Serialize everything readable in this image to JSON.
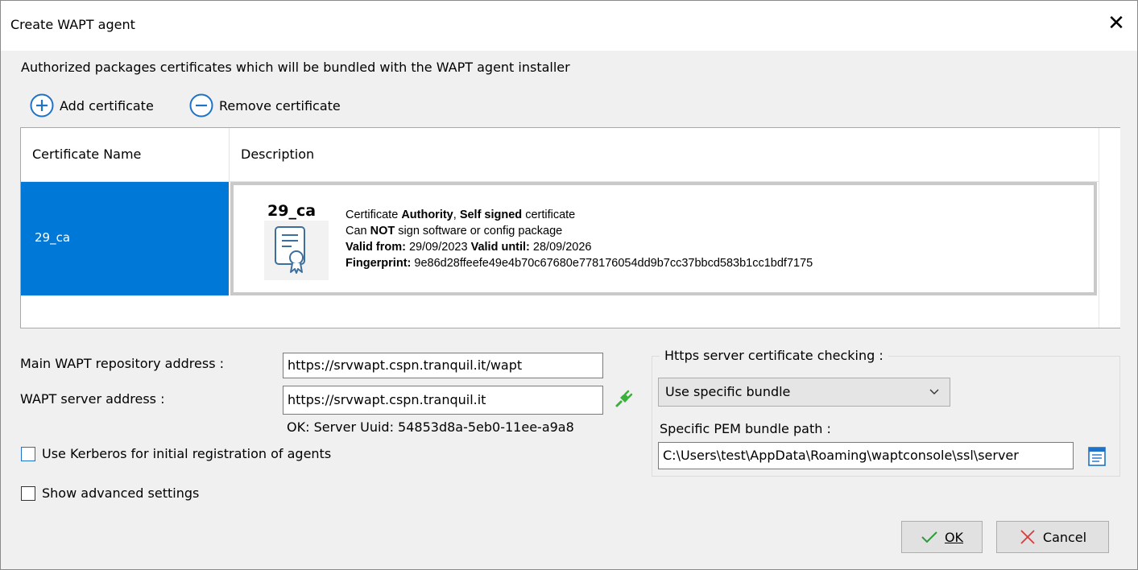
{
  "window": {
    "title": "Create WAPT agent",
    "close_glyph": "✕"
  },
  "certificates": {
    "heading": "Authorized packages certificates which will be bundled with the WAPT agent installer",
    "add_label": "Add certificate",
    "remove_label": "Remove certificate",
    "columns": [
      "Certificate Name",
      "Description"
    ],
    "rows": [
      {
        "name": "29_ca",
        "big_name": "29_ca",
        "line1": {
          "a": "Certificate ",
          "b": "Authority",
          "c": ", ",
          "d": "Self signed",
          "e": " certificate"
        },
        "line2": {
          "a": "Can ",
          "b": "NOT",
          "c": " sign software or config package"
        },
        "line3": {
          "a": "Valid from:",
          "b": " 29/09/2023 ",
          "c": "Valid until:",
          "d": " 28/09/2026"
        },
        "line4": {
          "a": "Fingerprint:",
          "b": " 9e86d28ffeefe49e4b70c67680e778176054dd9b7cc37bbcd583b1cc1bdf7175"
        }
      }
    ]
  },
  "repository": {
    "label": "Main WAPT repository address :",
    "value": "https://srvwapt.cspn.tranquil.it/wapt"
  },
  "server": {
    "label": "WAPT server address :",
    "value": "https://srvwapt.cspn.tranquil.it",
    "status": "OK: Server Uuid: 54853d8a-5eb0-11ee-a9a8",
    "status_icon": "plug-connected-icon"
  },
  "kerberos": {
    "label": "Use Kerberos for initial registration of agents",
    "checked": false
  },
  "advanced": {
    "label": "Show advanced settings",
    "checked": false
  },
  "https_check": {
    "caption": "Https server certificate checking :",
    "selected": "Use specific bundle",
    "pem_label": "Specific PEM bundle path :",
    "pem_value": "C:\\Users\\test\\AppData\\Roaming\\waptconsole\\ssl\\server"
  },
  "buttons": {
    "ok": "OK",
    "cancel": "Cancel"
  },
  "colors": {
    "selection": "#0078d7",
    "icon_blue": "#1e73c9",
    "plug_green": "#3cb03c",
    "ok_green": "#2e9b3a",
    "cancel_red": "#d83b3b"
  }
}
